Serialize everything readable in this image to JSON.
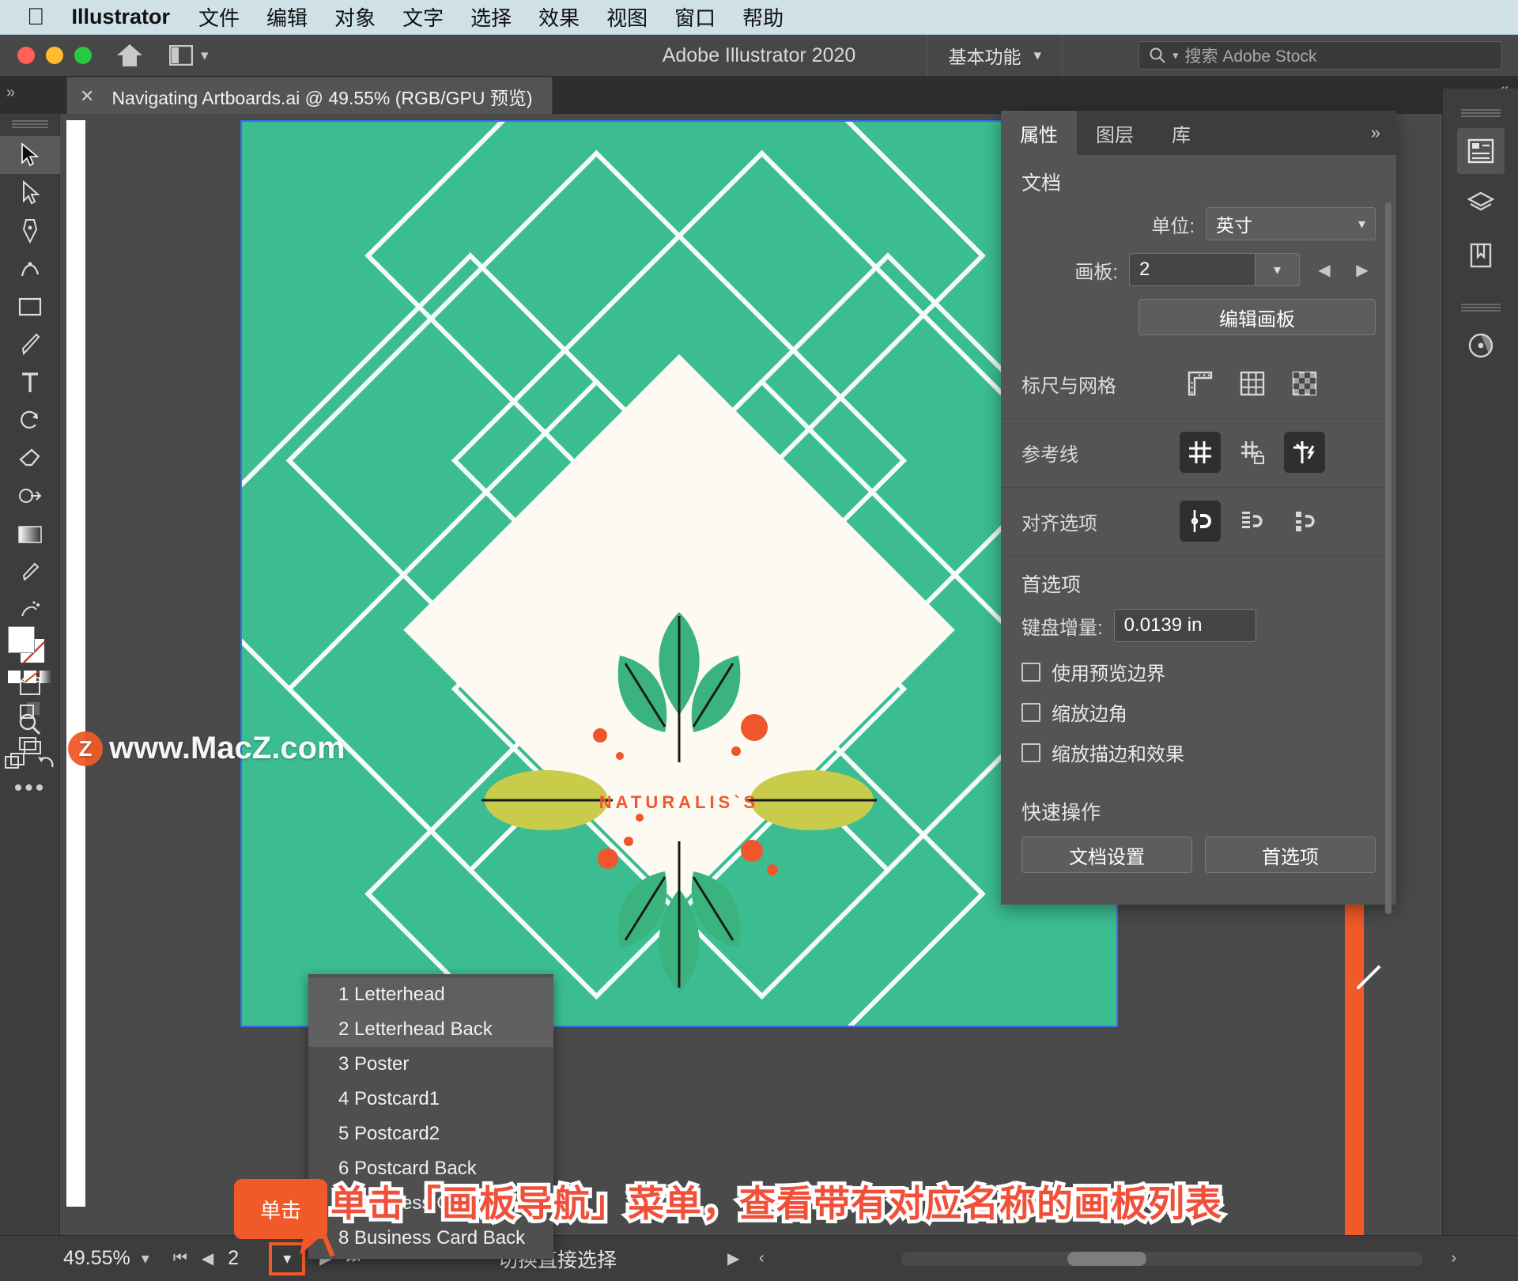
{
  "menubar": {
    "apple_icon": "apple-logo-icon",
    "app_name": "Illustrator",
    "items": [
      "文件",
      "编辑",
      "对象",
      "文字",
      "选择",
      "效果",
      "视图",
      "窗口",
      "帮助"
    ]
  },
  "titlebar": {
    "home_icon": "home-icon",
    "arrange_icon": "arrange-documents-icon",
    "arrange_chevron": "chevron-down-icon",
    "title": "Adobe Illustrator 2020",
    "workspace": "基本功能",
    "workspace_chevron": "chevron-down-icon",
    "search_icon": "search-icon",
    "search_chevron": "chevron-down-icon",
    "search_placeholder": "搜索 Adobe Stock"
  },
  "tabbar": {
    "close_icon": "close-icon",
    "doc_title": "Navigating Artboards.ai @ 49.55% (RGB/GPU 预览)",
    "collapse_left_icon": "expand-panel-icon",
    "collapse_right_icon": "collapse-panel-icon"
  },
  "toolbar": {
    "tools": [
      {
        "name": "selection-tool",
        "selected": true
      },
      {
        "name": "direct-selection-tool",
        "selected": false
      },
      {
        "name": "pen-tool",
        "selected": false
      },
      {
        "name": "curvature-tool",
        "selected": false
      },
      {
        "name": "rectangle-tool",
        "selected": false
      },
      {
        "name": "paintbrush-tool",
        "selected": false
      },
      {
        "name": "type-tool",
        "selected": false
      },
      {
        "name": "rotate-tool",
        "selected": false
      },
      {
        "name": "eraser-tool",
        "selected": false
      },
      {
        "name": "shape-builder-tool",
        "selected": false
      },
      {
        "name": "gradient-tool",
        "selected": false
      },
      {
        "name": "eyedropper-tool",
        "selected": false
      },
      {
        "name": "symbol-sprayer-tool",
        "selected": false
      },
      {
        "name": "free-transform-tool",
        "selected": false
      },
      {
        "name": "artboard-tool",
        "selected": false
      },
      {
        "name": "zoom-tool",
        "selected": false
      }
    ],
    "fill_swatch_color": "#ffffff",
    "stroke_swatch_color": "#ffffff",
    "more_tools_icon": "ellipsis-icon"
  },
  "canvas": {
    "artboard_bg_color": "#3bbd91",
    "artboard_border_color": "#3b6df0",
    "logo_text": "NATURALIS`S",
    "accent_orange": "#f05a28",
    "accent_olive": "#c8cc4a",
    "leaf_green": "#3ab37f",
    "watermark": "www.MacZ.com",
    "watermark_badge": "Z"
  },
  "artboard_menu": {
    "items": [
      {
        "label": "1 Letterhead",
        "highlight": "hover"
      },
      {
        "label": "2 Letterhead Back",
        "highlight": "selected"
      },
      {
        "label": "3 Poster",
        "highlight": "none"
      },
      {
        "label": "4 Postcard1",
        "highlight": "none"
      },
      {
        "label": "5 Postcard2",
        "highlight": "none"
      },
      {
        "label": "6 Postcard Back",
        "highlight": "none"
      },
      {
        "label": "7 Business Card",
        "highlight": "none"
      },
      {
        "label": "8 Business Card Back",
        "highlight": "none"
      }
    ]
  },
  "properties_panel": {
    "tabs": [
      {
        "label": "属性",
        "active": true
      },
      {
        "label": "图层",
        "active": false
      },
      {
        "label": "库",
        "active": false
      }
    ],
    "overflow_icon": "chevron-double-right-icon",
    "document": {
      "title": "文档",
      "unit_label": "单位:",
      "unit_value": "英寸",
      "unit_chevron": "chevron-down-icon",
      "artboard_label": "画板:",
      "artboard_value": "2",
      "artboard_chevron": "chevron-down-icon",
      "prev_icon": "triangle-left-icon",
      "next_icon": "triangle-right-icon",
      "edit_artboards_button": "编辑画板"
    },
    "rulers_grid": {
      "label": "标尺与网格",
      "buttons": [
        {
          "name": "show-rulers-icon",
          "active": false
        },
        {
          "name": "show-grid-icon",
          "active": false
        },
        {
          "name": "show-transparency-grid-icon",
          "active": false
        }
      ]
    },
    "guides": {
      "label": "参考线",
      "buttons": [
        {
          "name": "show-guides-icon",
          "active": true
        },
        {
          "name": "lock-guides-icon",
          "active": false
        },
        {
          "name": "smart-guides-icon",
          "active": true
        }
      ]
    },
    "align_options": {
      "label": "对齐选项",
      "buttons": [
        {
          "name": "snap-to-point-icon",
          "active": true
        },
        {
          "name": "snap-to-grid-icon",
          "active": false
        },
        {
          "name": "snap-to-pixel-icon",
          "active": false
        }
      ]
    },
    "preferences": {
      "title": "首选项",
      "keyboard_increment_label": "键盘增量:",
      "keyboard_increment_value": "0.0139 in",
      "checkboxes": [
        {
          "label": "使用预览边界",
          "checked": false
        },
        {
          "label": "缩放边角",
          "checked": false
        },
        {
          "label": "缩放描边和效果",
          "checked": false
        }
      ]
    },
    "quick_actions": {
      "title": "快速操作",
      "buttons": [
        "文档设置",
        "首选项"
      ]
    }
  },
  "right_dock": {
    "buttons": [
      {
        "name": "properties-panel-icon",
        "active": true
      },
      {
        "name": "layers-panel-icon",
        "active": false
      },
      {
        "name": "libraries-panel-icon",
        "active": false
      },
      {
        "name": "color-guide-panel-icon",
        "active": false
      }
    ]
  },
  "statusbar": {
    "zoom_value": "49.55%",
    "zoom_chevron": "chevron-down-icon",
    "first_artboard_icon": "skip-first-icon",
    "prev_artboard_icon": "triangle-left-icon",
    "artboard_number": "2",
    "artboard_chevron": "chevron-down-icon",
    "next_artboard_icon": "triangle-right-icon",
    "last_artboard_icon": "skip-last-icon",
    "status_text": "切换直接选择",
    "status_arrow_icon": "triangle-right-icon",
    "scroll_left_icon": "chevron-left-icon",
    "scroll_right_icon": "chevron-right-icon"
  },
  "annotations": {
    "callout_label": "单击",
    "instruction": "单击「画板导航」菜单，查看带有对应名称的画板列表"
  }
}
